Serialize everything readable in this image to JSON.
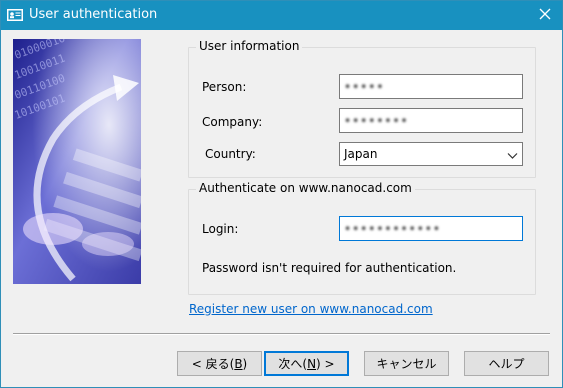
{
  "window": {
    "title": "User authentication",
    "close_glyph": "✕"
  },
  "user_info": {
    "group_title": "User information",
    "person_label": "Person:",
    "person_value": "•••••",
    "company_label": "Company:",
    "company_value": "••••••••",
    "country_label": "Country:",
    "country_value": "Japan"
  },
  "auth": {
    "group_title": "Authenticate on www.nanocad.com",
    "login_label": "Login:",
    "login_value": "••••••••••••",
    "password_note": "Password isn't required for authentication."
  },
  "register_link": "Register new user on www.nanocad.com",
  "buttons": {
    "back": "< 戻る(",
    "back_key": "B",
    "back_end": ")",
    "next": "次へ(",
    "next_key": "N",
    "next_end": ") >",
    "cancel": "キャンセル",
    "help": "ヘルプ"
  },
  "icons": {
    "app": "id-card-icon",
    "close": "close-icon",
    "dropdown": "chevron-down-icon"
  },
  "colors": {
    "titlebar": "#1891c0",
    "link": "#0066cc",
    "focus": "#0078d7"
  }
}
